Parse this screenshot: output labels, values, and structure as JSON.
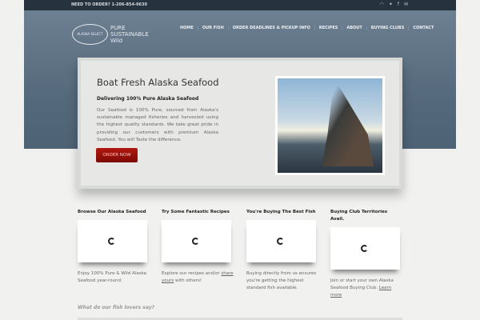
{
  "topbar": {
    "phone": "NEED TO ORDER? 1-206-854-9630",
    "social": [
      "rss-icon",
      "twitter-icon",
      "facebook-icon",
      "email-icon"
    ]
  },
  "logo": {
    "text": "ALASKA SELECT",
    "tagline": [
      "PURE",
      "SUSTAINABLE",
      "Wild"
    ]
  },
  "nav": [
    "HOME",
    "OUR FISH",
    "ORDER DEADLINES & PICKUP INFO",
    "RECIPES",
    "ABOUT",
    "BUYING CLUBS",
    "CONTACT"
  ],
  "hero": {
    "title": "Boat Fresh Alaska Seafood",
    "subtitle": "Delivering 100% Pure Alaska Seafood",
    "body": "Our Seafood is 100% Pure, sourced from Alaska's sustainable managed fisheries and harvested using the highest quality standards. We take great pride in providing our customers with premium Alaska Seafood. You will Taste the difference.",
    "button": "ORDER NOW"
  },
  "columns": [
    {
      "title": "Browse Our Alaska Seafood",
      "text": "Enjoy 100% Pure & Wild Alaska Seafood year-round."
    },
    {
      "title": "Try Some Fantastic Recipes",
      "text_before": "Explore our recipes and/or ",
      "link": "share yours",
      "text_after": " with others!"
    },
    {
      "title": "You're Buying The Best Fish",
      "text": "Buying directly from us ensures you're getting the highest standard fish available."
    },
    {
      "title": "Buying Club Territories Avail.",
      "text": "Join or start your own Alaska Seafood Buying Club. ",
      "link": "Learn more"
    }
  ],
  "testimonials_heading": "What do our fish lovers say?"
}
